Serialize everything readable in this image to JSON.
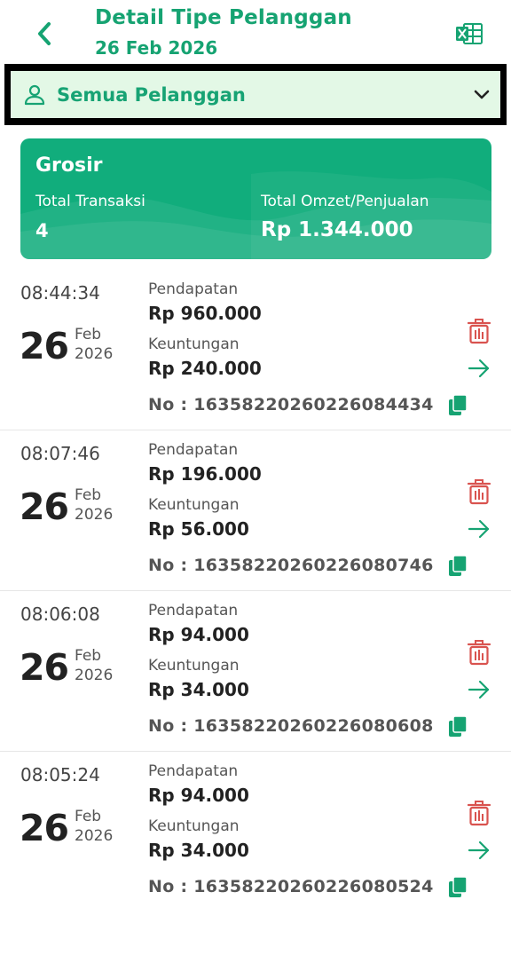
{
  "header": {
    "title": "Detail Tipe Pelanggan",
    "date": "26 Feb 2026"
  },
  "filter": {
    "label": "Semua Pelanggan"
  },
  "summary": {
    "title": "Grosir",
    "total_transaksi_label": "Total Transaksi",
    "total_transaksi_value": "4",
    "total_omzet_label": "Total Omzet/Penjualan",
    "total_omzet_value": "Rp 1.344.000"
  },
  "transactions": [
    {
      "time": "08:44:34",
      "day": "26",
      "month": "Feb",
      "year": "2026",
      "pendapatan_label": "Pendapatan",
      "pendapatan": "Rp 960.000",
      "keuntungan_label": "Keuntungan",
      "keuntungan": "Rp 240.000",
      "no": "No : 16358220260226084434"
    },
    {
      "time": "08:07:46",
      "day": "26",
      "month": "Feb",
      "year": "2026",
      "pendapatan_label": "Pendapatan",
      "pendapatan": "Rp 196.000",
      "keuntungan_label": "Keuntungan",
      "keuntungan": "Rp 56.000",
      "no": "No : 16358220260226080746"
    },
    {
      "time": "08:06:08",
      "day": "26",
      "month": "Feb",
      "year": "2026",
      "pendapatan_label": "Pendapatan",
      "pendapatan": "Rp 94.000",
      "keuntungan_label": "Keuntungan",
      "keuntungan": "Rp 34.000",
      "no": "No : 16358220260226080608"
    },
    {
      "time": "08:05:24",
      "day": "26",
      "month": "Feb",
      "year": "2026",
      "pendapatan_label": "Pendapatan",
      "pendapatan": "Rp 94.000",
      "keuntungan_label": "Keuntungan",
      "keuntungan": "Rp 34.000",
      "no": "No : 16358220260226080524"
    }
  ],
  "icons": {
    "back": "chevron-left-icon",
    "export": "excel-icon",
    "filter": "person-icon",
    "dropdown": "chevron-down-icon",
    "delete": "trash-icon",
    "open": "arrow-right-icon",
    "copy": "copy-icon"
  },
  "colors": {
    "brand_green": "#16a372",
    "card_green": "#11ad7c",
    "filter_bg": "#e3f8e6",
    "delete_red": "#d9534f"
  }
}
